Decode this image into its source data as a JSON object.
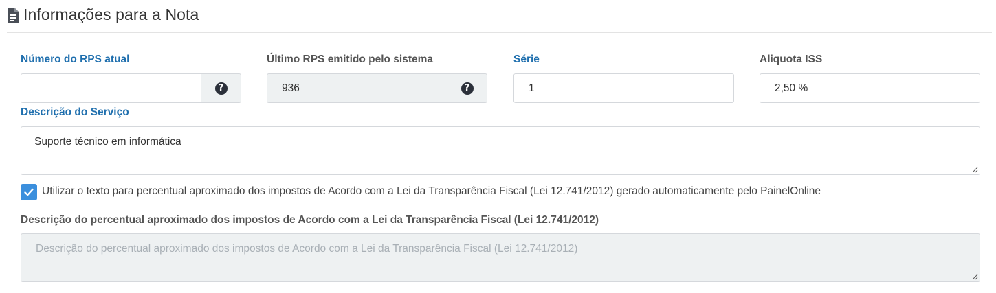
{
  "section": {
    "title": "Informações para a Nota",
    "icon": "document-icon"
  },
  "rps_atual": {
    "label": "Número do RPS atual",
    "value": "",
    "help_icon": "question-circle-icon"
  },
  "ultimo_rps": {
    "label": "Último RPS emitido pelo sistema",
    "value": "936",
    "help_icon": "question-circle-icon"
  },
  "serie": {
    "label": "Série",
    "value": "1"
  },
  "aliquota": {
    "label": "Aliquota ISS",
    "value": "2,50 %"
  },
  "descricao_servico": {
    "label": "Descrição do Serviço",
    "value": "Suporte técnico em informática"
  },
  "transparencia_checkbox": {
    "checked": true,
    "label": "Utilizar o texto para percentual aproximado dos impostos de Acordo com a Lei da Transparência Fiscal (Lei 12.741/2012) gerado automaticamente pelo PainelOnline"
  },
  "descricao_percentual": {
    "label": "Descrição do percentual aproximado dos impostos de Acordo com a Lei da Transparência Fiscal (Lei 12.741/2012)",
    "placeholder": "Descrição do percentual aproximado dos impostos de Acordo com a Lei da Transparência Fiscal (Lei 12.741/2012)"
  },
  "colors": {
    "label_blue": "#1f6fae",
    "checkbox_blue": "#3b8fdd",
    "disabled_bg": "#eef1f2"
  }
}
